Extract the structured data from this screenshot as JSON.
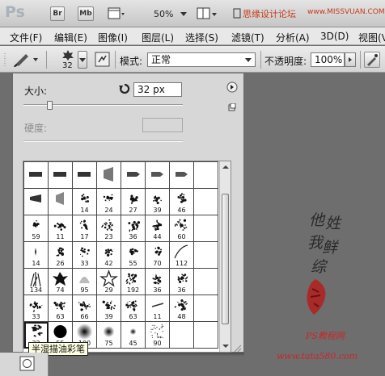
{
  "app_bar": {
    "logo": "Ps",
    "bridge": "Br",
    "minibridge": "Mb",
    "zoom": "50%",
    "title_cn": "思缘设计论坛",
    "title_url": "www.MISSVUAN.COM"
  },
  "menu": {
    "items": [
      "文件(F)",
      "编辑(E)",
      "图像(I)",
      "图层(L)",
      "选择(S)",
      "滤镜(T)",
      "分析(A)",
      "3D(D)",
      "视图(V)"
    ]
  },
  "options_bar": {
    "brush_size": "32",
    "mode_label": "模式:",
    "mode_value": "正常",
    "opacity_label": "不透明度:",
    "opacity_value": "100%"
  },
  "brush_panel": {
    "size_label": "大小:",
    "size_value": "32 px",
    "hardness_label": "硬度:",
    "size_slider_fraction": 0.16,
    "rows": [
      [
        "",
        "",
        "",
        "",
        "",
        "",
        "",
        ""
      ],
      [
        "",
        "",
        "14",
        "24",
        "27",
        "39",
        "46",
        ""
      ],
      [
        "59",
        "11",
        "17",
        "23",
        "36",
        "44",
        "60",
        ""
      ],
      [
        "14",
        "26",
        "33",
        "42",
        "55",
        "70",
        "112",
        ""
      ],
      [
        "134",
        "74",
        "95",
        "29",
        "192",
        "36",
        "36",
        ""
      ],
      [
        "33",
        "63",
        "66",
        "39",
        "63",
        "11",
        "48",
        ""
      ],
      [
        "32",
        "55",
        "100",
        "75",
        "45",
        "90",
        "",
        ""
      ]
    ],
    "tooltip": "半湿描油彩笔"
  },
  "watermark": {
    "chars": [
      "他",
      "姓",
      "我",
      "鲜",
      "综"
    ],
    "site_cn": "PS教程网",
    "site_url": "www.tata580.com"
  },
  "colors": {
    "accent_red": "#c62828",
    "panel_bg": "#d7d7d7",
    "canvas_bg": "#6e6e6e"
  }
}
